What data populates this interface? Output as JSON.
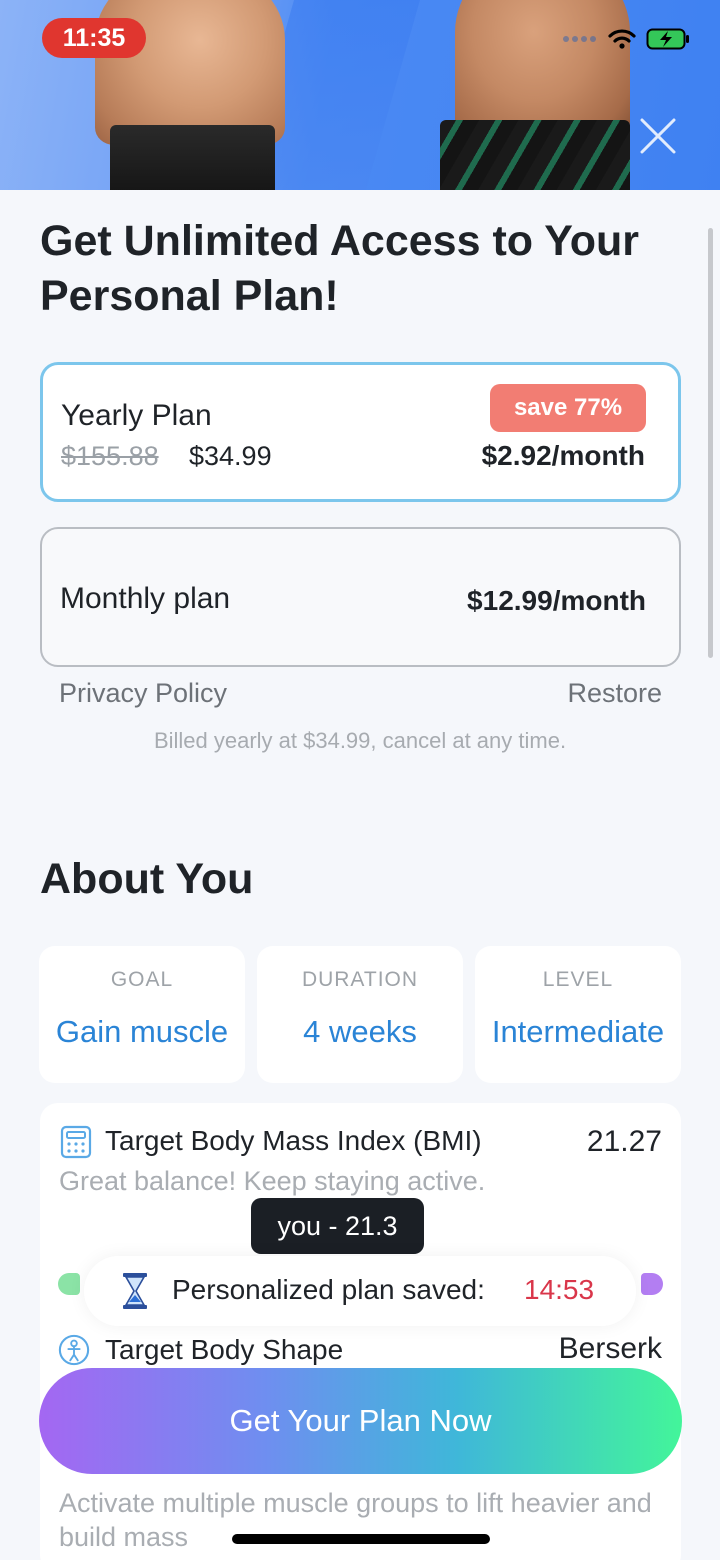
{
  "status_bar": {
    "time": "11:35"
  },
  "headline": "Get Unlimited Access to Your Personal Plan!",
  "plans": {
    "yearly": {
      "name": "Yearly Plan",
      "old_price": "$155.88",
      "new_price": "$34.99",
      "badge": "save 77%",
      "per_month": "$2.92/month"
    },
    "monthly": {
      "name": "Monthly plan",
      "per_month": "$12.99/month"
    }
  },
  "links": {
    "privacy": "Privacy Policy",
    "restore": "Restore"
  },
  "billed_note": "Billed yearly at $34.99, cancel at any time.",
  "about": {
    "title": "About You",
    "stats": [
      {
        "key": "GOAL",
        "value": "Gain muscle"
      },
      {
        "key": "DURATION",
        "value": "4 weeks"
      },
      {
        "key": "LEVEL",
        "value": "Intermediate"
      }
    ],
    "bmi": {
      "title": "Target Body Mass Index (BMI)",
      "value": "21.27",
      "desc": "Great balance! Keep staying active.",
      "tooltip": "you - 21.3"
    },
    "saved": {
      "label": "Personalized plan saved:",
      "timer": "14:53"
    },
    "shape": {
      "title": "Target Body Shape",
      "value": "Berserk"
    },
    "exercise_desc": "Activate multiple muscle groups to lift heavier and build mass"
  },
  "cta": "Get Your Plan Now",
  "colors": {
    "accent_blue": "#2a84d6",
    "badge": "#f27d73",
    "timer_red": "#d9364a",
    "selected_border": "#7cc6ec"
  }
}
